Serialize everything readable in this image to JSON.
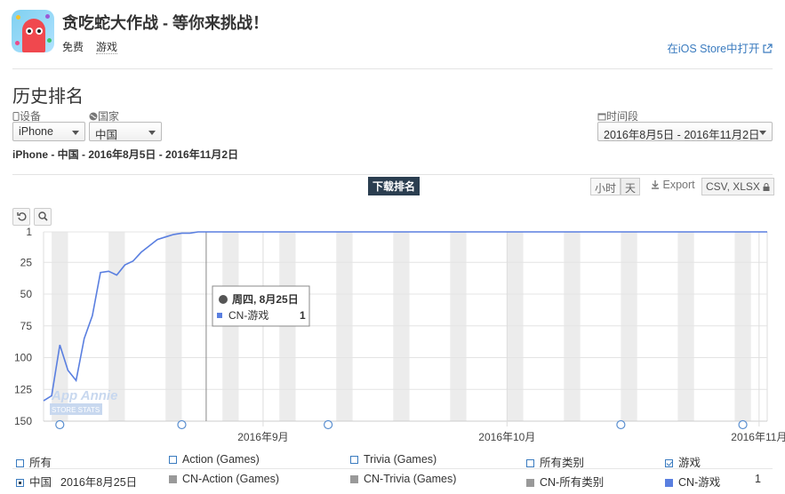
{
  "app": {
    "title": "贪吃蛇大作战 - 等你来挑战！",
    "price": "免费",
    "category": "游戏",
    "open_store": "在iOS Store中打开"
  },
  "section": {
    "title": "历史排名"
  },
  "filters": {
    "device_label": "设备",
    "device_value": "iPhone",
    "country_label": "国家",
    "country_value": "中国",
    "period_label": "时间段",
    "period_value": "2016年8月5日 - 2016年11月2日"
  },
  "subtitle": "iPhone - 中国 - 2016年8月5日 - 2016年11月2日",
  "toolbar": {
    "download_rank": "下载排名",
    "hour": "小时",
    "day": "天",
    "export": "Export",
    "csv": "CSV, XLSX"
  },
  "tooltip": {
    "date": "周四, 8月25日",
    "series": "CN-游戏",
    "value": "1"
  },
  "watermark": {
    "line1": "App Annie",
    "line2": "STORE STATS"
  },
  "chart_data": {
    "type": "line",
    "y_axis": {
      "reversed": true,
      "ticks": [
        1,
        25,
        50,
        75,
        100,
        125,
        150
      ],
      "range": [
        1,
        150
      ]
    },
    "x_axis": {
      "range": [
        "2016-08-05",
        "2016-11-02"
      ],
      "tick_labels": [
        "2016年9月",
        "2016年10月",
        "2016年11月"
      ],
      "tick_dates": [
        "2016-09-01",
        "2016-10-01",
        "2016-11-01"
      ]
    },
    "series": [
      {
        "name": "CN-游戏",
        "color": "#5a7fe0",
        "points": [
          [
            "2016-08-05",
            134
          ],
          [
            "2016-08-06",
            130
          ],
          [
            "2016-08-07",
            90
          ],
          [
            "2016-08-08",
            110
          ],
          [
            "2016-08-09",
            118
          ],
          [
            "2016-08-10",
            85
          ],
          [
            "2016-08-11",
            67
          ],
          [
            "2016-08-12",
            33
          ],
          [
            "2016-08-13",
            32
          ],
          [
            "2016-08-14",
            35
          ],
          [
            "2016-08-15",
            27
          ],
          [
            "2016-08-16",
            24
          ],
          [
            "2016-08-17",
            17
          ],
          [
            "2016-08-18",
            12
          ],
          [
            "2016-08-19",
            7
          ],
          [
            "2016-08-20",
            5
          ],
          [
            "2016-08-21",
            3
          ],
          [
            "2016-08-22",
            2
          ],
          [
            "2016-08-23",
            2
          ],
          [
            "2016-08-24",
            1
          ],
          [
            "2016-08-25",
            1
          ],
          [
            "2016-11-02",
            1
          ]
        ]
      }
    ],
    "event_markers": [
      "2016-08-07",
      "2016-08-22",
      "2016-09-09",
      "2016-10-15",
      "2016-10-30"
    ]
  },
  "legend": {
    "row1": [
      {
        "label": "所有",
        "state": "unchecked"
      },
      {
        "label": "Action (Games)",
        "state": "unchecked"
      },
      {
        "label": "Trivia (Games)",
        "state": "unchecked"
      },
      {
        "label": "所有类别",
        "state": "unchecked"
      },
      {
        "label": "游戏",
        "state": "checked"
      }
    ],
    "row2": {
      "country": "中国",
      "date": "2016年8月25日",
      "items": [
        {
          "label": "CN-Action (Games)",
          "value": ""
        },
        {
          "label": "CN-Trivia (Games)",
          "value": ""
        },
        {
          "label": "CN-所有类别",
          "value": ""
        },
        {
          "label": "CN-游戏",
          "value": "1"
        }
      ]
    }
  }
}
